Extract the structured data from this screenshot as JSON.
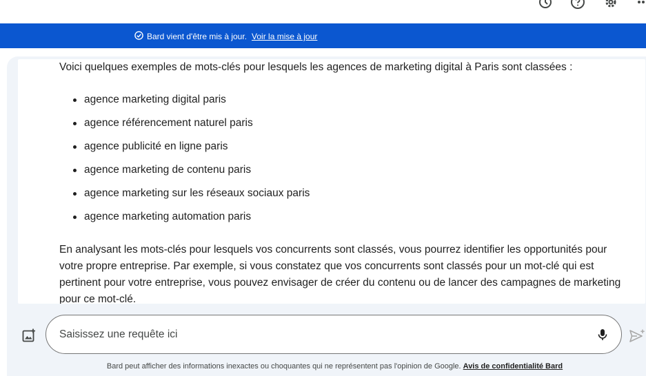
{
  "top_bar": {
    "icons": [
      "history-icon",
      "help-icon",
      "settings-icon",
      "apps-icon"
    ]
  },
  "banner": {
    "message": "Bard vient d'être mis à jour.",
    "link": "Voir la mise à jour",
    "color": "#0b57d0"
  },
  "response": {
    "intro": "Voici quelques exemples de mots-clés pour lesquels les agences de marketing digital à Paris sont classées :",
    "keywords": [
      "agence marketing digital paris",
      "agence référencement naturel paris",
      "agence publicité en ligne paris",
      "agence marketing de contenu paris",
      "agence marketing sur les réseaux sociaux paris",
      "agence marketing automation paris"
    ],
    "paragraph": "En analysant les mots-clés pour lesquels vos concurrents sont classés, vous pourrez identifier les opportunités pour votre propre entreprise. Par exemple, si vous constatez que vos concurrents sont classés pour un mot-clé qui est pertinent pour votre entreprise, vous pouvez envisager de créer du contenu ou de lancer des campagnes de marketing pour ce mot-clé."
  },
  "composer": {
    "placeholder": "Saisissez une requête ici",
    "value": "",
    "icons": [
      "add-image-icon",
      "microphone-icon",
      "send-icon"
    ]
  },
  "footer": {
    "disclaimer": "Bard peut afficher des informations inexactes ou choquantes qui ne représentent pas l'opinion de Google.",
    "privacy_link": "Avis de confidentialité Bard"
  }
}
